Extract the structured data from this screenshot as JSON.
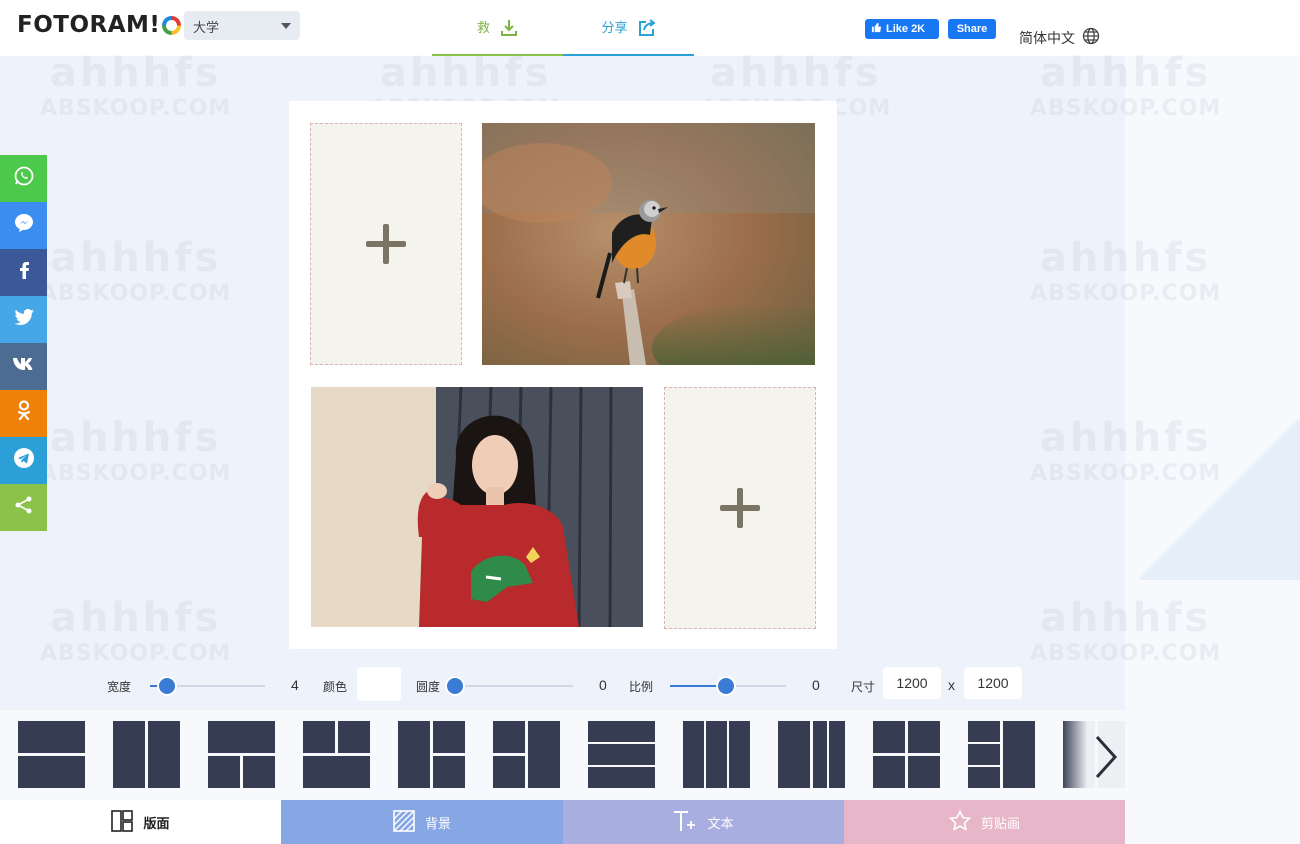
{
  "header": {
    "logo_text": "FOTORAM!",
    "category_select": "大学",
    "tab_save": "救",
    "tab_share": "分享",
    "fb_like": "Like 2K",
    "fb_share": "Share",
    "language": "简体中文"
  },
  "share_bar": {
    "buttons": [
      {
        "name": "whatsapp",
        "color": "#4cc94a"
      },
      {
        "name": "messenger",
        "color": "#3b8df0"
      },
      {
        "name": "facebook",
        "color": "#3b5998"
      },
      {
        "name": "twitter",
        "color": "#45a6e8"
      },
      {
        "name": "vk",
        "color": "#4c6c91"
      },
      {
        "name": "odnoklassniki",
        "color": "#ee8208"
      },
      {
        "name": "telegram",
        "color": "#2a9fd8"
      },
      {
        "name": "share",
        "color": "#8bc34a"
      }
    ]
  },
  "controls": {
    "width_label": "宽度",
    "width_value": "4",
    "width_fraction": 0.15,
    "color_label": "颜色",
    "roundness_label": "圆度",
    "roundness_value": "0",
    "roundness_fraction": 0.0,
    "ratio_label": "比例",
    "ratio_value": "0",
    "ratio_fraction": 0.48,
    "size_label": "尺寸",
    "size_width": "1200",
    "size_separator": "x",
    "size_height": "1200"
  },
  "layout_strip": {
    "thumb_color": "#363d52",
    "thumb_count": 12
  },
  "bottom_tabs": {
    "layout": "版面",
    "background": "背景",
    "text": "文本",
    "clipart": "剪贴画"
  },
  "watermark": {
    "line1": "ahhhfs",
    "line2": "ABSKOOP.COM"
  }
}
